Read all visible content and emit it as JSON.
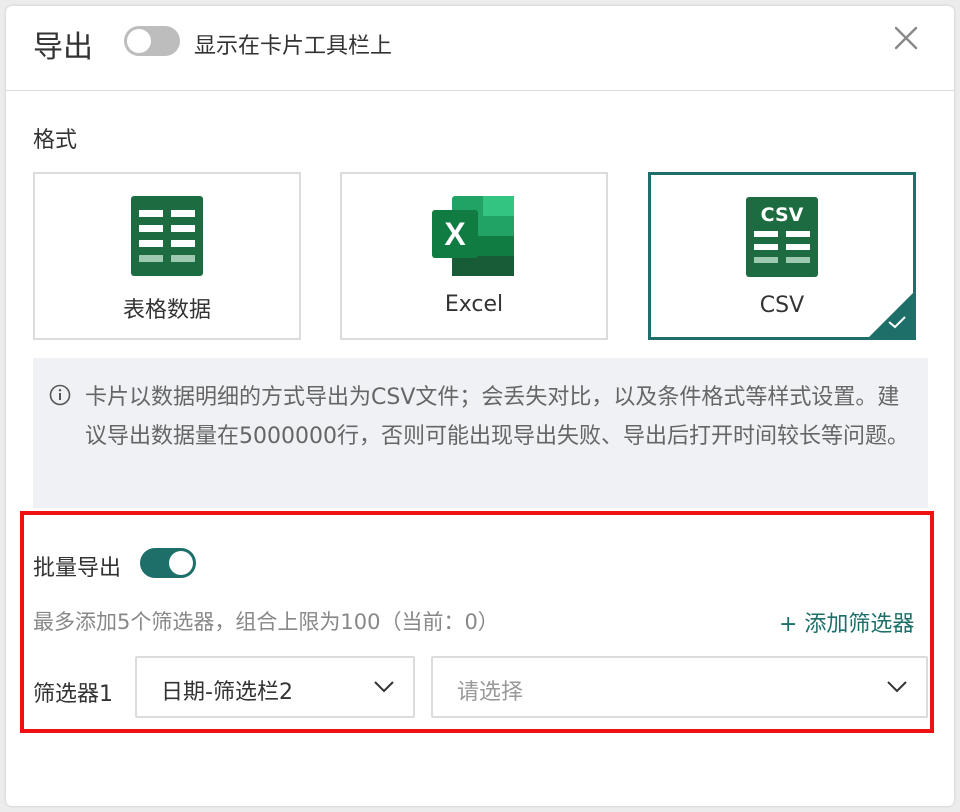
{
  "dialog": {
    "title": "导出",
    "toolbar_toggle": {
      "label": "显示在卡片工具栏上",
      "on": false
    },
    "close_icon": "close-icon"
  },
  "format": {
    "label": "格式",
    "options": [
      {
        "label": "表格数据",
        "icon": "table-data-icon",
        "selected": false
      },
      {
        "label": "Excel",
        "icon": "excel-icon",
        "selected": false
      },
      {
        "label": "CSV",
        "icon": "csv-icon",
        "icon_text": "CSV",
        "selected": true
      }
    ]
  },
  "info": {
    "icon": "info-icon",
    "text": "卡片以数据明细的方式导出为CSV文件；会丢失对比，以及条件格式等样式设置。建议导出数据量在5000000行，否则可能出现导出失败、导出后打开时间较长等问题。"
  },
  "batch": {
    "label": "批量导出",
    "on": true,
    "hint": "最多添加5个筛选器，组合上限为100（当前：0）",
    "add_filter": "+ 添加筛选器",
    "filters": [
      {
        "label": "筛选器1",
        "field_value": "日期-筛选栏2",
        "value_placeholder": "请选择"
      }
    ]
  },
  "colors": {
    "accent": "#1e6f69",
    "excel_green": "#1d6b40",
    "highlight_red": "#ee1111"
  }
}
